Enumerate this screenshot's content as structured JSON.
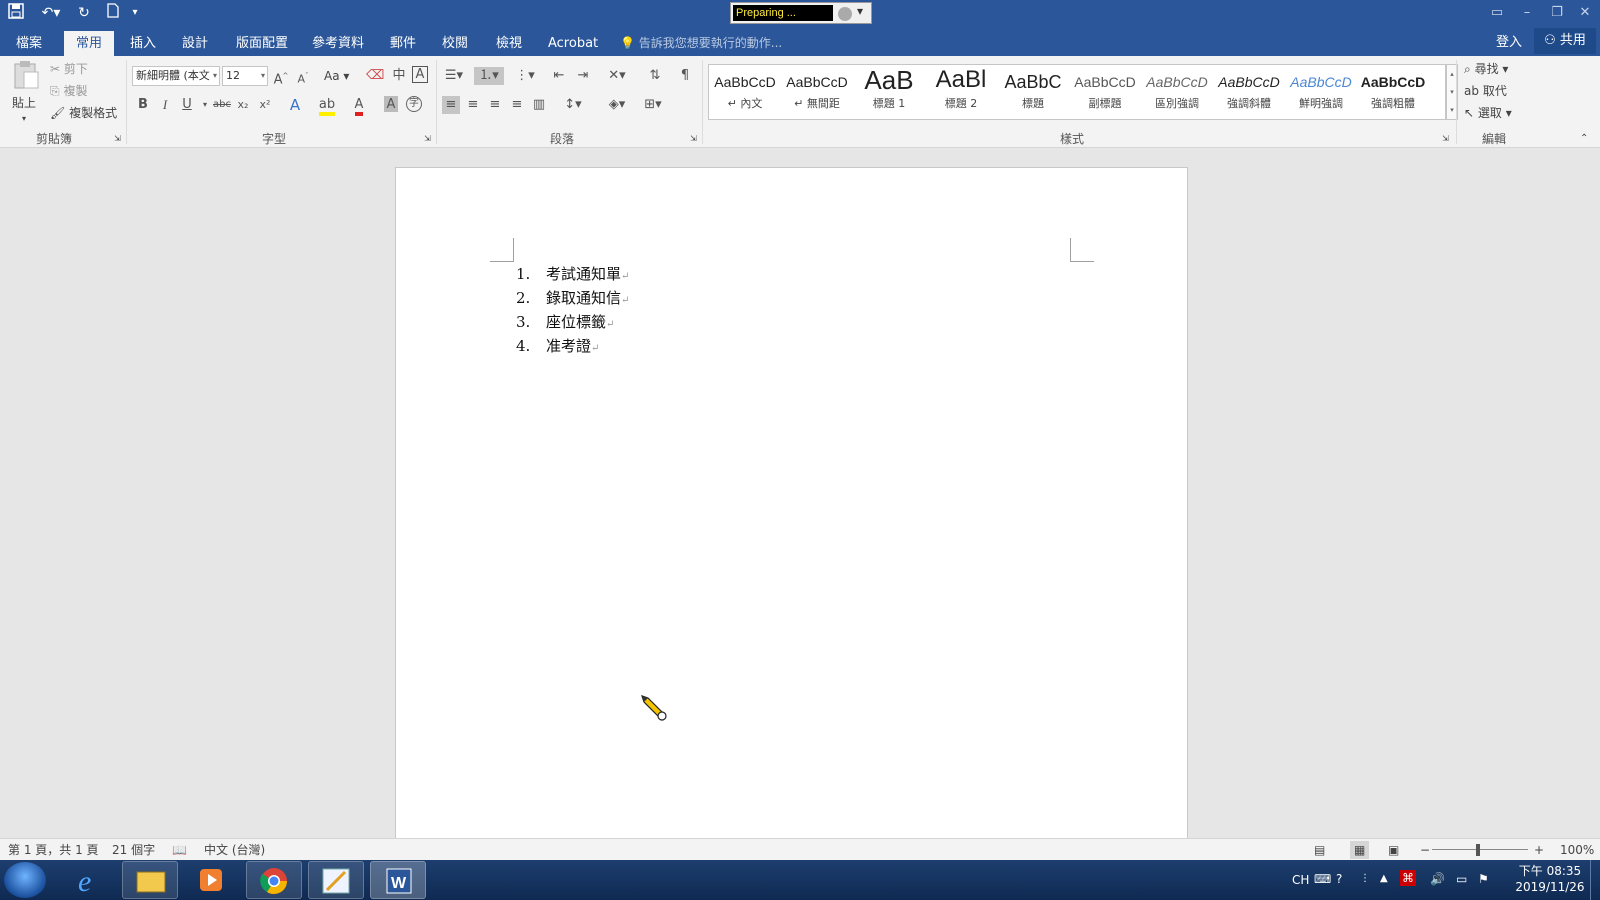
{
  "titlebar": {
    "recorder_status": "Preparing ...",
    "qat": {
      "save_icon": "save-icon",
      "undo_icon": "undo-icon",
      "redo_icon": "redo-icon",
      "new_icon": "new-doc-icon"
    }
  },
  "tabs": [
    "檔案",
    "常用",
    "插入",
    "設計",
    "版面配置",
    "參考資料",
    "郵件",
    "校閱",
    "檢視",
    "Acrobat"
  ],
  "active_tab": "常用",
  "tellme": "告訴我您想要執行的動作...",
  "signin": "登入",
  "share": "共用",
  "clipboard": {
    "paste": "貼上",
    "cut": "剪下",
    "copy": "複製",
    "format_painter": "複製格式",
    "label": "剪貼簿"
  },
  "font": {
    "name": "新細明體 (本文",
    "size": "12",
    "label": "字型",
    "change_case": "Aa",
    "bold": "B",
    "italic": "I",
    "underline": "U",
    "strike": "abc",
    "sub": "x₂",
    "sup": "x²"
  },
  "paragraph": {
    "label": "段落"
  },
  "styles": {
    "label": "樣式",
    "items": [
      {
        "sample": "AaBbCcD",
        "name": "↵ 內文"
      },
      {
        "sample": "AaBbCcD",
        "name": "↵ 無間距"
      },
      {
        "sample": "AaB",
        "name": "標題 1"
      },
      {
        "sample": "AaBl",
        "name": "標題 2"
      },
      {
        "sample": "AaBbC",
        "name": "標題"
      },
      {
        "sample": "AaBbCcD",
        "name": "副標題"
      },
      {
        "sample": "AaBbCcD",
        "name": "區別強調"
      },
      {
        "sample": "AaBbCcD",
        "name": "強調斜體"
      },
      {
        "sample": "AaBbCcD",
        "name": "鮮明強調"
      },
      {
        "sample": "AaBbCcD",
        "name": "強調粗體"
      }
    ]
  },
  "editing": {
    "find": "尋找",
    "replace": "取代",
    "select": "選取",
    "label": "編輯"
  },
  "document": {
    "list": [
      {
        "num": "1.",
        "text": "考試通知單"
      },
      {
        "num": "2.",
        "text": "錄取通知信"
      },
      {
        "num": "3.",
        "text": "座位標籤"
      },
      {
        "num": "4.",
        "text": "准考證"
      }
    ],
    "para_mark": "↵"
  },
  "statusbar": {
    "page": "第 1 頁，共 1 頁",
    "words": "21 個字",
    "language": "中文 (台灣)",
    "zoom": "100%",
    "zoom_minus": "−",
    "zoom_plus": "+"
  },
  "taskbar": {
    "ime": "CH",
    "time": "下午 08:35",
    "date": "2019/11/26"
  },
  "colors": {
    "accent": "#2b579a",
    "ribbon": "#f3f3f3",
    "canvas": "#e6e6e6"
  }
}
